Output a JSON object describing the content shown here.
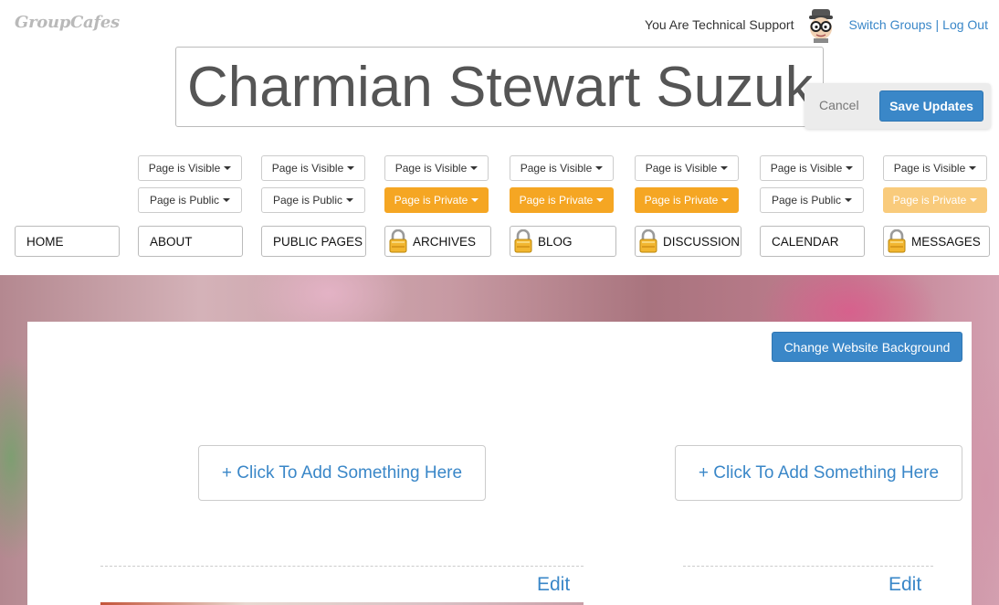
{
  "brand": {
    "logo_text": "GroupCafes"
  },
  "user": {
    "role_text": "You Are Technical Support",
    "switch_groups": "Switch Groups",
    "separator": "|",
    "logout": "Log Out"
  },
  "title": {
    "value": "Charmian Stewart Suzuki",
    "cancel_label": "Cancel",
    "save_label": "Save Updates"
  },
  "pages": [
    {
      "visibility": "Page is Visible",
      "access": "Page is Public",
      "label": "HOME",
      "locked": false
    },
    {
      "visibility": "Page is Visible",
      "access": "Page is Public",
      "label": "ABOUT",
      "locked": false
    },
    {
      "visibility": "Page is Visible",
      "access": "Page is Public",
      "label": "PUBLIC PAGES",
      "locked": false
    },
    {
      "visibility": "Page is Visible",
      "access": "Page is Private",
      "label": "ARCHIVES",
      "locked": true
    },
    {
      "visibility": "Page is Visible",
      "access": "Page is Private",
      "label": "BLOG",
      "locked": true
    },
    {
      "visibility": "Page is Visible",
      "access": "Page is Private",
      "label": "DISCUSSION",
      "locked": true
    },
    {
      "visibility": "Page is Visible",
      "access": "Page is Public",
      "label": "CALENDAR",
      "locked": false
    },
    {
      "visibility": "Page is Visible",
      "access": "Page is Private",
      "label": "MESSAGES",
      "locked": true
    }
  ],
  "content": {
    "change_background_label": "Change Website Background",
    "add_left": "+ Click To Add Something Here",
    "add_right": "+ Click To Add Something Here",
    "edit_left": "Edit",
    "edit_right": "Edit"
  },
  "colors": {
    "accent": "#3a87c8",
    "private": "#f5a623"
  }
}
